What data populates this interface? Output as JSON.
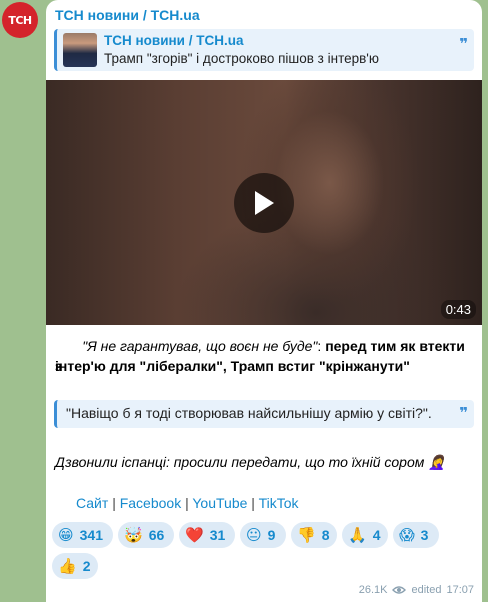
{
  "channel": {
    "avatar_text": "ТСН",
    "name": "ТСН новини / TCH.ua"
  },
  "reply": {
    "title": "ТСН новини / TCH.ua",
    "text": "Трамп \"згорів\" і достроково пішов з інтерв'ю"
  },
  "video": {
    "duration": "0:43"
  },
  "message": {
    "line1_italic": "\"Я не гарантував, що воєн не буде\"",
    "line1_colon": ": ",
    "line1_bold": "перед тим як втекти з",
    "line2_bold": "інтер'ю для \"лібералки\", Трамп встиг \"крінжанути\"",
    "quote": "\"Навіщо б я тоді створював найсильнішу армію у світі?\".",
    "italic_line": "Дзвонили іспанці: просили передати, що то їхній сором 🤦‍♀️"
  },
  "links": {
    "site": "Сайт",
    "facebook": "Facebook",
    "youtube": "YouTube",
    "tiktok": "TikTok",
    "sep": "|"
  },
  "reactions": [
    {
      "emoji": "😁",
      "count": "341"
    },
    {
      "emoji": "🤯",
      "count": "66"
    },
    {
      "emoji": "❤️",
      "count": "31"
    },
    {
      "emoji": "😐",
      "count": "9"
    },
    {
      "emoji": "👎",
      "count": "8"
    },
    {
      "emoji": "🙏",
      "count": "4"
    },
    {
      "emoji": "😱",
      "count": "3"
    },
    {
      "emoji": "👍",
      "count": "2"
    }
  ],
  "meta": {
    "views": "26.1K",
    "edited": "edited",
    "time": "17:07"
  }
}
